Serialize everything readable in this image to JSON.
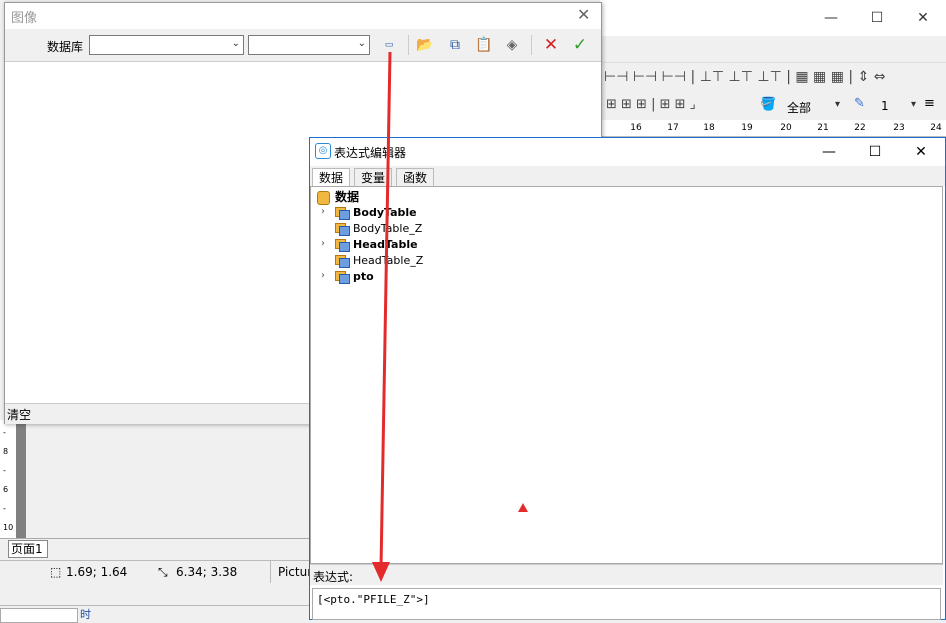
{
  "image_dialog": {
    "title": "图像",
    "database_label": "数据库",
    "database_select_value": "",
    "field_select_value": "",
    "clear_label": "清空",
    "toolbar_icons": [
      "field-select-icon",
      "open-folder-icon",
      "copy-icon",
      "paste-icon",
      "eraser-icon",
      "cancel-icon",
      "confirm-icon"
    ]
  },
  "designer": {
    "ruler_ticks": [
      "5",
      "16",
      "17",
      "18",
      "19",
      "20",
      "21",
      "22",
      "23",
      "24"
    ],
    "scope_select_value": "全部",
    "line_width_value": "1",
    "page_tab": "页面1",
    "status_position": "1.69; 1.64",
    "status_size": "6.34; 3.38",
    "status_object": "Pictur",
    "left_ruler_marks": [
      "-",
      "8",
      "-",
      "6",
      "-",
      "10"
    ],
    "bottom_fragment": "时"
  },
  "expression_editor": {
    "title": "表达式编辑器",
    "tabs": [
      "数据",
      "变量",
      "函数"
    ],
    "tree": {
      "root": "数据",
      "items": [
        {
          "label": "BodyTable",
          "bold": true,
          "expandable": true
        },
        {
          "label": "BodyTable_Z",
          "bold": false,
          "expandable": false
        },
        {
          "label": "HeadTable",
          "bold": true,
          "expandable": true
        },
        {
          "label": "HeadTable_Z",
          "bold": false,
          "expandable": false
        },
        {
          "label": "pto",
          "bold": true,
          "expandable": true
        }
      ]
    },
    "expression_label": "表达式:",
    "expression_value": "[<pto.\"PFILE_Z\">]"
  },
  "colors": {
    "accent": "#1a6fd0",
    "annotation_red": "#e32b2b",
    "confirm_green": "#2e9e2e",
    "cancel_red": "#d42020"
  }
}
